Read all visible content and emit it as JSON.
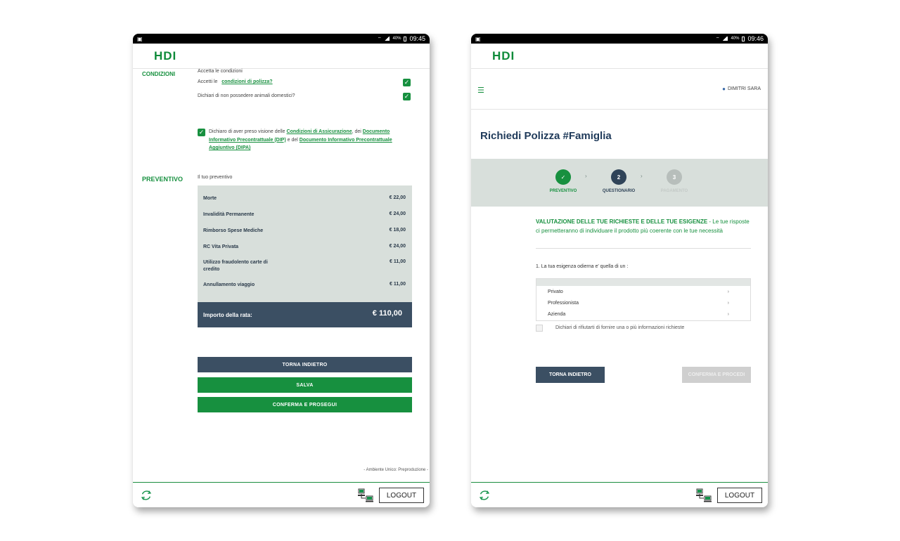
{
  "colors": {
    "brand_green": "#17903f",
    "dark_slate": "#3b4f63",
    "panel_gray": "#d8dfdb",
    "logo_red": "#d6001c"
  },
  "left_device": {
    "status": {
      "time": "09:45",
      "battery": "40%"
    },
    "logo": "HDI",
    "conditions": {
      "section_label": "CONDIZIONI",
      "intro": "Accetta le condizioni",
      "accept_prefix": "Accetti le",
      "accept_link": "condizioni di polizza?",
      "no_pets": "Dichiari di non possedere animali domestici?",
      "declaration": {
        "part1": "Dichiaro di aver preso visione delle",
        "link1": "Condizioni di Assicurazione",
        "part2": ", dei",
        "link2": "Documento Informativo Precontrattuale (DIP)",
        "part3": "e del",
        "link3": "Documento Informativo Precontrattuale Aggiuntivo (DIPA)"
      }
    },
    "quote": {
      "section_label": "PREVENTIVO",
      "subtitle": "Il tuo preventivo",
      "rows": [
        {
          "name": "Morte",
          "value": "€ 22,00"
        },
        {
          "name": "Invalidità Permanente",
          "value": "€ 24,00"
        },
        {
          "name": "Rimborso Spese Mediche",
          "value": "€ 18,00"
        },
        {
          "name": "RC Vita Privata",
          "value": "€ 24,00"
        },
        {
          "name": "Utilizzo fraudolento carte di credito",
          "value": "€ 11,00"
        },
        {
          "name": "Annullamento viaggio",
          "value": "€ 11,00"
        }
      ],
      "total_label": "Importo della rata:",
      "total_value": "€ 110,00"
    },
    "buttons": {
      "back": "TORNA INDIETRO",
      "save": "SALVA",
      "confirm": "CONFERMA E PROSEGUI"
    },
    "footer_note": "- Ambiente Unico: Preproduzione -",
    "logout": "LOGOUT"
  },
  "right_device": {
    "status": {
      "time": "09:46",
      "battery": "40%"
    },
    "logo": "HDI",
    "user_name": "DIMITRI SARA",
    "page_title": "Richiedi Polizza #Famiglia",
    "steps": [
      {
        "number": "✓",
        "label": "PREVENTIVO",
        "state": "done"
      },
      {
        "number": "2",
        "label": "QUESTIONARIO",
        "state": "active"
      },
      {
        "number": "3",
        "label": "PAGAMENTO",
        "state": "pending"
      }
    ],
    "step_separator": "›",
    "evaluation": {
      "heading": "VALUTAZIONE DELLE TUE RICHIESTE E DELLE TUE ESIGENZE",
      "rest": " - Le tue risposte ci permetteranno di individuare il prodotto più coerente con le tue necessità"
    },
    "question": "1. La tua esigenza odierna e' quella di un :",
    "options": [
      "Privato",
      "Professionista",
      "Azienda"
    ],
    "option_chevron": "›",
    "refuse_text": "Dichiari di rifiutarti di fornire una o più informazioni richieste",
    "buttons": {
      "back": "TORNA INDIETRO",
      "confirm": "CONFERMA E PROCEDI"
    },
    "logout": "LOGOUT"
  }
}
